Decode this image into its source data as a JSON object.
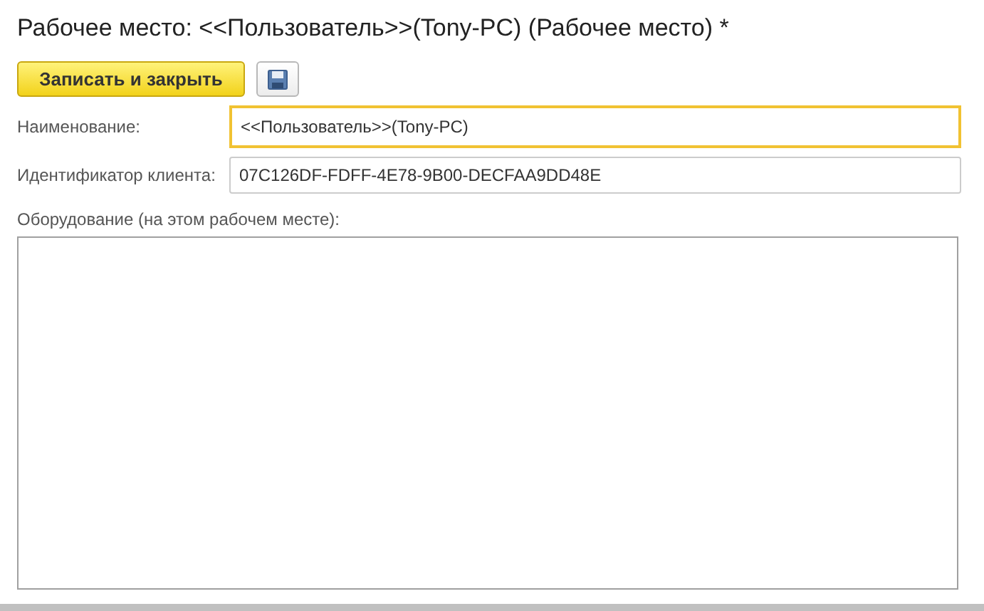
{
  "window": {
    "title": "Рабочее место: <<Пользователь>>(Tony-PC) (Рабочее место) *"
  },
  "toolbar": {
    "buttons": [
      {
        "kind": "primary",
        "label": "Записать и закрыть"
      },
      {
        "kind": "save-icon"
      }
    ]
  },
  "fields": [
    {
      "label": "Наименование:",
      "value": "<<Пользователь>>(Tony-PC)",
      "focused": true
    },
    {
      "label": "Идентификатор клиента:",
      "value": "07C126DF-FDFF-4E78-9B00-DECFAA9DD48E",
      "focused": false
    }
  ],
  "equipment": {
    "label": "Оборудование (на этом рабочем месте):"
  }
}
